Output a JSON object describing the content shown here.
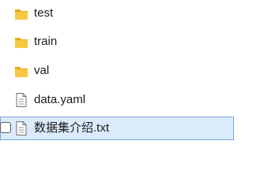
{
  "files": [
    {
      "name": "test",
      "type": "folder",
      "icon": "folder-icon"
    },
    {
      "name": "train",
      "type": "folder",
      "icon": "folder-icon"
    },
    {
      "name": "val",
      "type": "folder",
      "icon": "folder-icon"
    },
    {
      "name": "data.yaml",
      "type": "file",
      "icon": "document-icon"
    },
    {
      "name": "数据集介绍.txt",
      "type": "file",
      "icon": "document-icon",
      "selected": true
    }
  ],
  "colors": {
    "folder": "#f7c843",
    "folder_dark": "#e6a817",
    "selection_bg": "#dcebfc",
    "selection_border": "#7aa7d9"
  }
}
